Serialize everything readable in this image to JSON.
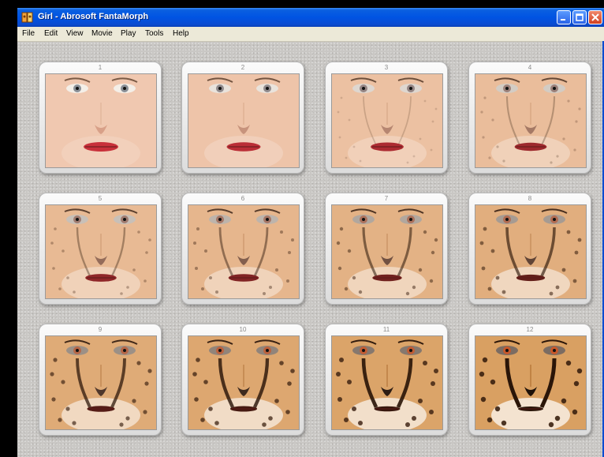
{
  "window": {
    "title": "Girl - Abrosoft FantaMorph",
    "icon": "fantamorph-app-icon",
    "controls": [
      "minimize-icon",
      "maximize-icon",
      "close-icon"
    ]
  },
  "menu": [
    "File",
    "Edit",
    "View",
    "Movie",
    "Play",
    "Tools",
    "Help"
  ],
  "frames": [
    {
      "number": "1",
      "morph": 0.0
    },
    {
      "number": "2",
      "morph": 0.09
    },
    {
      "number": "3",
      "morph": 0.18
    },
    {
      "number": "4",
      "morph": 0.27
    },
    {
      "number": "5",
      "morph": 0.36
    },
    {
      "number": "6",
      "morph": 0.45
    },
    {
      "number": "7",
      "morph": 0.55
    },
    {
      "number": "8",
      "morph": 0.64
    },
    {
      "number": "9",
      "morph": 0.73
    },
    {
      "number": "10",
      "morph": 0.82
    },
    {
      "number": "11",
      "morph": 0.91
    },
    {
      "number": "12",
      "morph": 1.0
    }
  ],
  "colors": {
    "titlebar": "#0054e3",
    "workspace": "#c9c7c4",
    "human_skin": "#f0c8b0",
    "cheetah_fur": "#d9a062",
    "lips": "#c8303a"
  }
}
